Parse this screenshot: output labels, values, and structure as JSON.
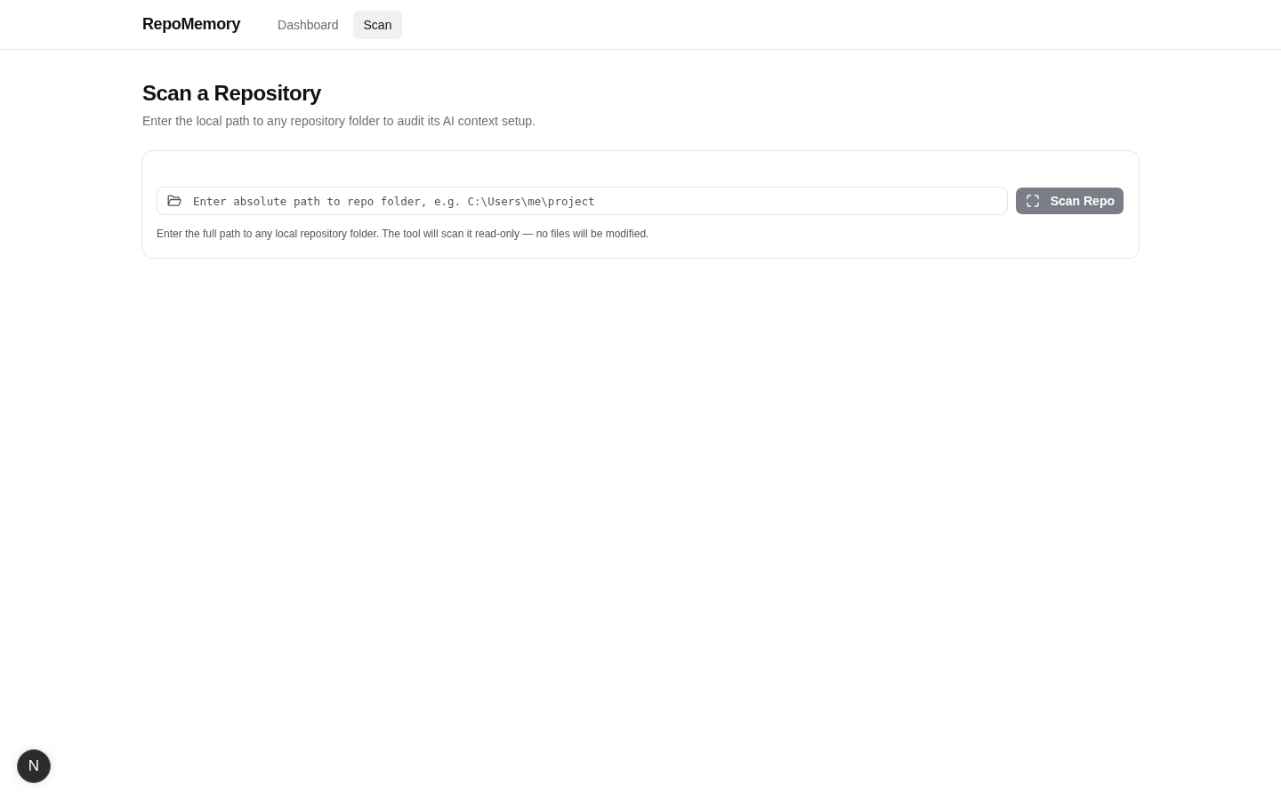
{
  "header": {
    "brand": "RepoMemory",
    "nav": [
      {
        "label": "Dashboard",
        "selected": false
      },
      {
        "label": "Scan",
        "selected": true
      }
    ]
  },
  "page": {
    "title": "Scan a Repository",
    "subtitle": "Enter the local path to any repository folder to audit its AI context setup."
  },
  "scan_form": {
    "path_field": {
      "placeholder": "Enter absolute path to repo folder, e.g. C:\\Users\\me\\project"
    },
    "scan_button": {
      "label": "Scan Repo",
      "disabled": true
    },
    "help_text": "Enter the full path to any local repository folder. The tool will scan it read-only — no files will be modified."
  },
  "dev_indicator": {
    "label": "N"
  }
}
